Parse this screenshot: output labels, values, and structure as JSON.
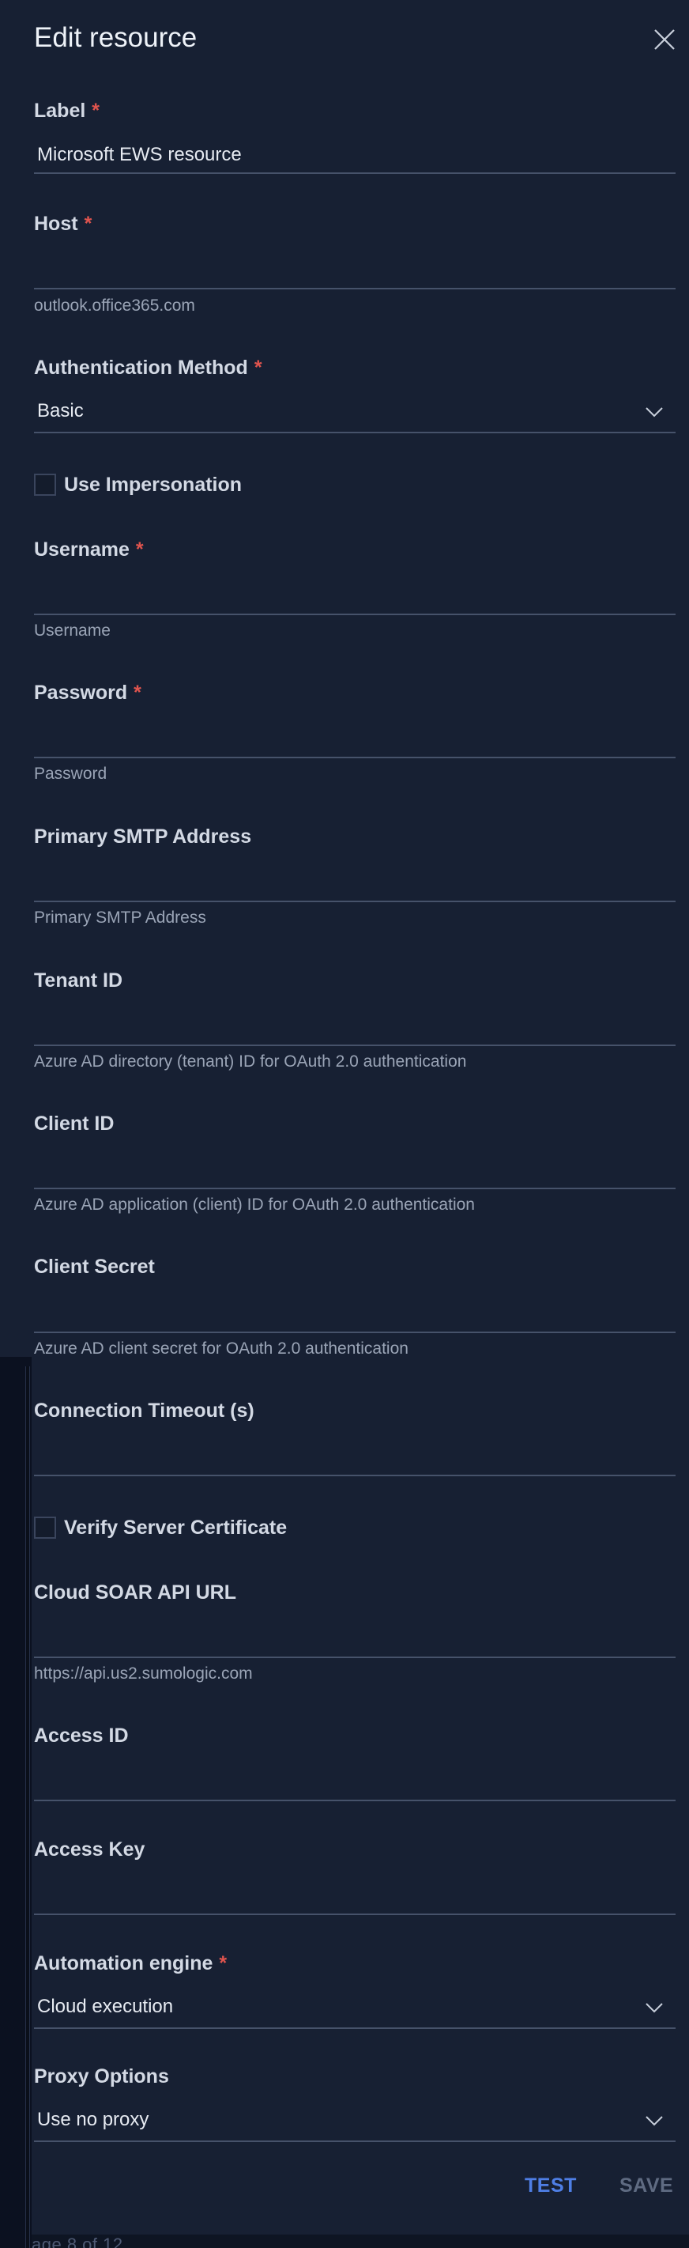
{
  "dialog": {
    "title": "Edit resource",
    "required_mark": "*"
  },
  "fields": {
    "label": {
      "label": "Label",
      "value": "Microsoft EWS resource",
      "required": true
    },
    "host": {
      "label": "Host",
      "value": "",
      "help": "outlook.office365.com",
      "required": true
    },
    "auth_method": {
      "label": "Authentication Method",
      "value": "Basic",
      "required": true
    },
    "use_impersonation": {
      "label": "Use Impersonation",
      "checked": false
    },
    "username": {
      "label": "Username",
      "value": "",
      "help": "Username",
      "required": true
    },
    "password": {
      "label": "Password",
      "value": "",
      "help": "Password",
      "required": true
    },
    "primary_smtp": {
      "label": "Primary SMTP Address",
      "value": "",
      "help": "Primary SMTP Address"
    },
    "tenant_id": {
      "label": "Tenant ID",
      "value": "",
      "help": "Azure AD directory (tenant) ID for OAuth 2.0 authentication"
    },
    "client_id": {
      "label": "Client ID",
      "value": "",
      "help": "Azure AD application (client) ID for OAuth 2.0 authentication"
    },
    "client_secret": {
      "label": "Client Secret",
      "value": "",
      "help": "Azure AD client secret for OAuth 2.0 authentication"
    },
    "connection_timeout": {
      "label": "Connection Timeout (s)",
      "value": ""
    },
    "verify_cert": {
      "label": "Verify Server Certificate",
      "checked": false
    },
    "cloud_soar_url": {
      "label": "Cloud SOAR API URL",
      "value": "",
      "help": "https://api.us2.sumologic.com"
    },
    "access_id": {
      "label": "Access ID",
      "value": ""
    },
    "access_key": {
      "label": "Access Key",
      "value": ""
    },
    "automation_engine": {
      "label": "Automation engine",
      "value": "Cloud execution",
      "required": true
    },
    "proxy_options": {
      "label": "Proxy Options",
      "value": "Use no proxy"
    }
  },
  "actions": {
    "test_label": "TEST",
    "save_label": "SAVE"
  },
  "underlay": {
    "pager_text": "age 8 of 12"
  },
  "colors": {
    "panel_bg": "#172033",
    "required": "#e0544e",
    "accent": "#4f7fe6",
    "disabled": "#5f6b82"
  },
  "icons": {
    "close": "close-icon",
    "dropdown": "chevron-down-icon"
  }
}
